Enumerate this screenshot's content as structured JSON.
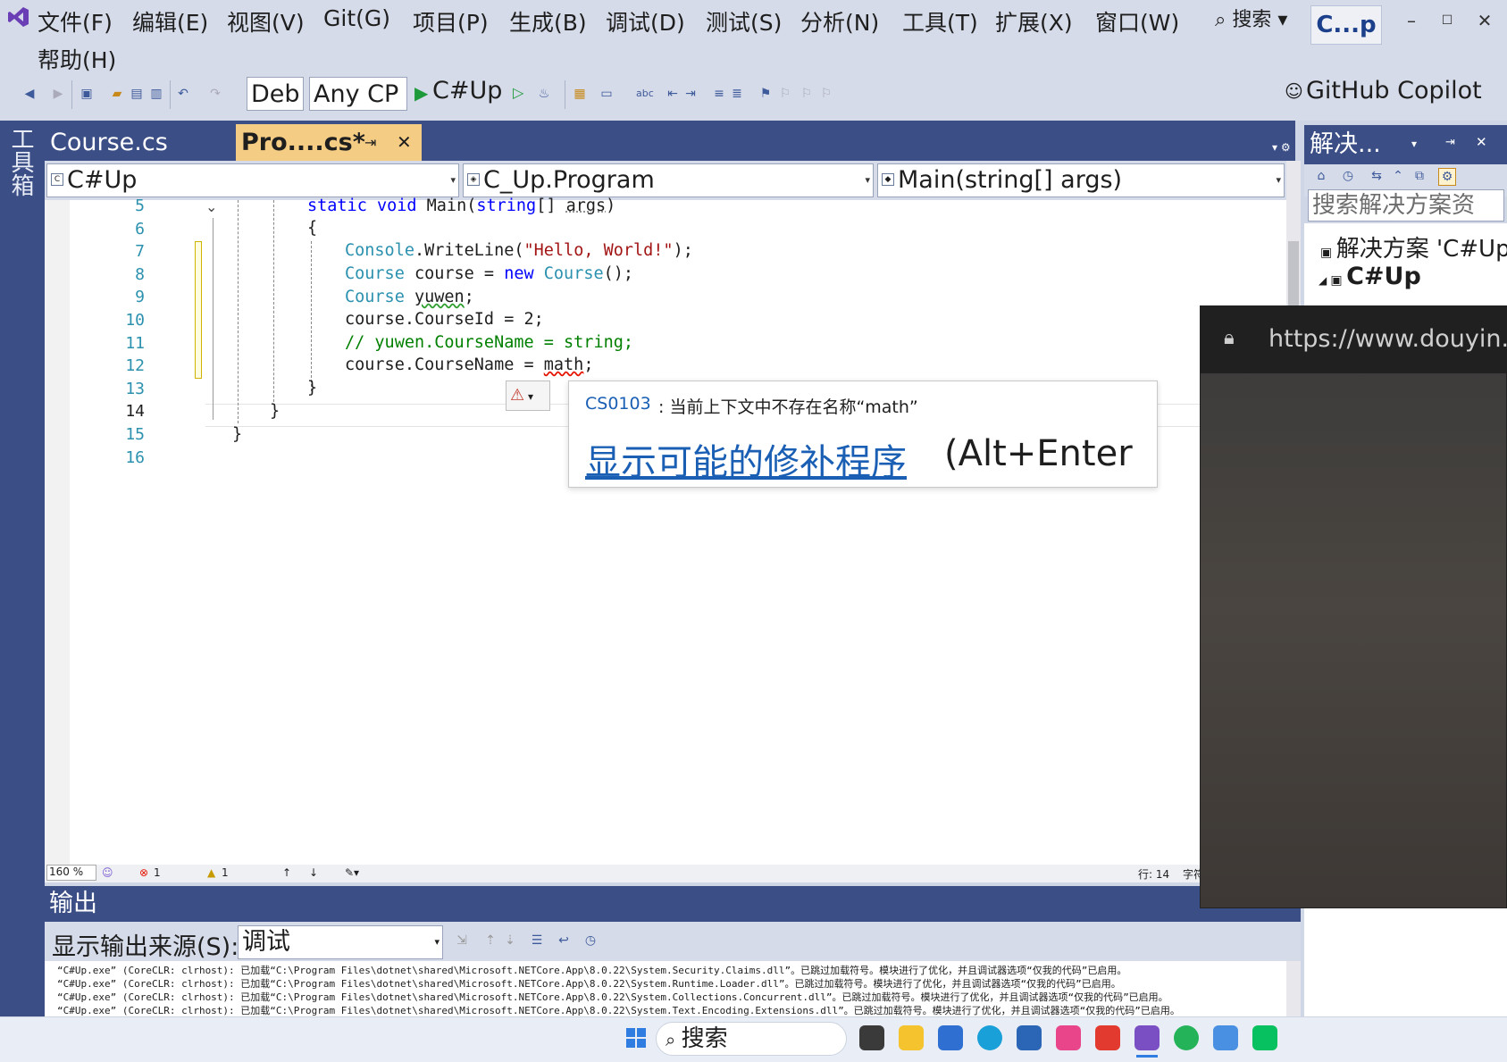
{
  "menu": [
    "文件(F)",
    "编辑(E)",
    "视图(V)",
    "Git(G)",
    "项目(P)",
    "生成(B)",
    "调试(D)",
    "测试(S)",
    "分析(N)",
    "工具(T)",
    "扩展(X)",
    "窗口(W)",
    "帮助(H)"
  ],
  "title_search": "搜索",
  "app_badge": "C...p",
  "window_controls": {
    "min": "–",
    "max": "☐",
    "close": "✕"
  },
  "toolbar": {
    "config": "Deb",
    "platform": "Any CP",
    "start_label": "C#Up",
    "copilot": "GitHub Copilot"
  },
  "toolbox_label": "工具箱",
  "tabs": [
    {
      "label": "Course.cs"
    },
    {
      "label": "Pro....cs*"
    }
  ],
  "tab_pin": "⇥",
  "tab_close": "✕",
  "nav": {
    "project": "C#Up",
    "class": "C_Up.Program",
    "member": "Main(string[] args)"
  },
  "code": {
    "line_numbers": [
      "5",
      "6",
      "7",
      "8",
      "9",
      "10",
      "11",
      "12",
      "13",
      "14",
      "15",
      "16"
    ],
    "l5a": "static void ",
    "l5b": "Main",
    "l5c": "(",
    "l5d": "string",
    "l5e": "[] ",
    "l5f": "args",
    ")": ")",
    "l6": "{",
    "l7a": "Console",
    "l7b": ".WriteLine(",
    "l7c": "\"Hello, World!\"",
    "l7d": ");",
    "l8a": "Course",
    "l8b": " course = ",
    "l8c": "new",
    "l8d": " ",
    "l8e": "Course",
    "l8f": "();",
    "l9a": "Course",
    "l9b": " ",
    "l9c": "yuwen",
    "l9d": ";",
    "l10": "course.CourseId = 2;",
    "l11": "// yuwen.CourseName = string;",
    "l12a": "course.CourseName = ",
    "l12b": "math",
    "l12c": ";",
    "l13": "}",
    "l14": "}",
    "l15": "}"
  },
  "tooltip": {
    "code": "CS0103",
    "message": ": 当前上下文中不存在名称“math”",
    "link": "显示可能的修补程序",
    "shortcut": "(Alt+Enter"
  },
  "editor_status": {
    "zoom": "160 %",
    "errors": "1",
    "warnings": "1",
    "line": "行: 14",
    "char": "字符"
  },
  "output": {
    "title": "输出",
    "source_label": "显示输出来源(S):",
    "source_value": "调试",
    "lines": [
      "“C#Up.exe” (CoreCLR: clrhost): 已加载“C:\\Program Files\\dotnet\\shared\\Microsoft.NETCore.App\\8.0.22\\System.Security.Claims.dll”。已跳过加载符号。模块进行了优化，并且调试器选项“仅我的代码”已启用。",
      "“C#Up.exe” (CoreCLR: clrhost): 已加载“C:\\Program Files\\dotnet\\shared\\Microsoft.NETCore.App\\8.0.22\\System.Runtime.Loader.dll”。已跳过加载符号。模块进行了优化，并且调试器选项“仅我的代码”已启用。",
      "“C#Up.exe” (CoreCLR: clrhost): 已加载“C:\\Program Files\\dotnet\\shared\\Microsoft.NETCore.App\\8.0.22\\System.Collections.Concurrent.dll”。已跳过加载符号。模块进行了优化，并且调试器选项“仅我的代码”已启用。",
      "“C#Up.exe” (CoreCLR: clrhost): 已加载“C:\\Program Files\\dotnet\\shared\\Microsoft.NETCore.App\\8.0.22\\System.Text.Encoding.Extensions.dll”。已跳过加载符号。模块进行了优化，并且调试器选项“仅我的代码”已启用。"
    ]
  },
  "solution": {
    "title": "解决...",
    "search_placeholder": "搜索解决方案资",
    "root": "解决方案 'C#Up",
    "project": "C#Up"
  },
  "overlay": {
    "url": "https://www.douyin.co"
  },
  "taskbar": {
    "search": "搜索"
  },
  "colors": {
    "accent": "#3b4e86",
    "active_tab": "#f5cc84",
    "error": "#e51400",
    "link": "#1a5fb4"
  }
}
